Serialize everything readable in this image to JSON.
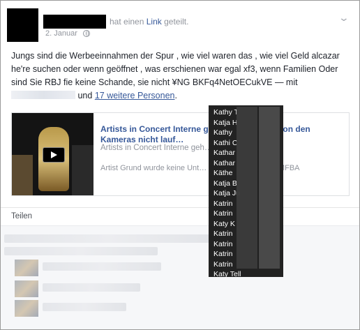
{
  "header": {
    "action_prefix": "hat einen",
    "action_link": "Link",
    "action_suffix": "geteilt.",
    "date": "2. Januar"
  },
  "post": {
    "text_main": "Jungs sind die Werbeeinnahmen der Spur , wie viel waren das , wie viel Geld alcazar he're suchen oder wenn geöffnet , was erschienen war egal xf3, wenn Familien Oder sind Sie RBJ fie keine Schande, sie nicht ¥NG BKFq4NetOECukVE — mit",
    "and_word": "und",
    "others_link": "17 weitere Personen",
    "period": "."
  },
  "link_preview": {
    "title": "Artists in Concert Interne ge…e ! oDT Bilder von den Kameras nicht lauf…",
    "description": "Artists in Concert Interne geh… …",
    "description2": "Artist Grund wurde keine Unt… lr All in den Details. IMFBA"
  },
  "actions": {
    "share": "Teilen"
  },
  "tooltip": {
    "names": [
      "Kathy T",
      "Katja H",
      "Kathy",
      "Kathi C",
      "Kathar",
      "Kathar",
      "Käthe",
      "Katja B",
      "Katja Ju",
      "Katrin",
      "Katrin",
      "Katy K",
      "Katrin",
      "Katrin",
      "Katrin",
      "Katrin",
      "Katy Tell"
    ]
  },
  "colors": {
    "link": "#365899",
    "meta": "#90949c",
    "tooltip_bg": "#222222"
  }
}
